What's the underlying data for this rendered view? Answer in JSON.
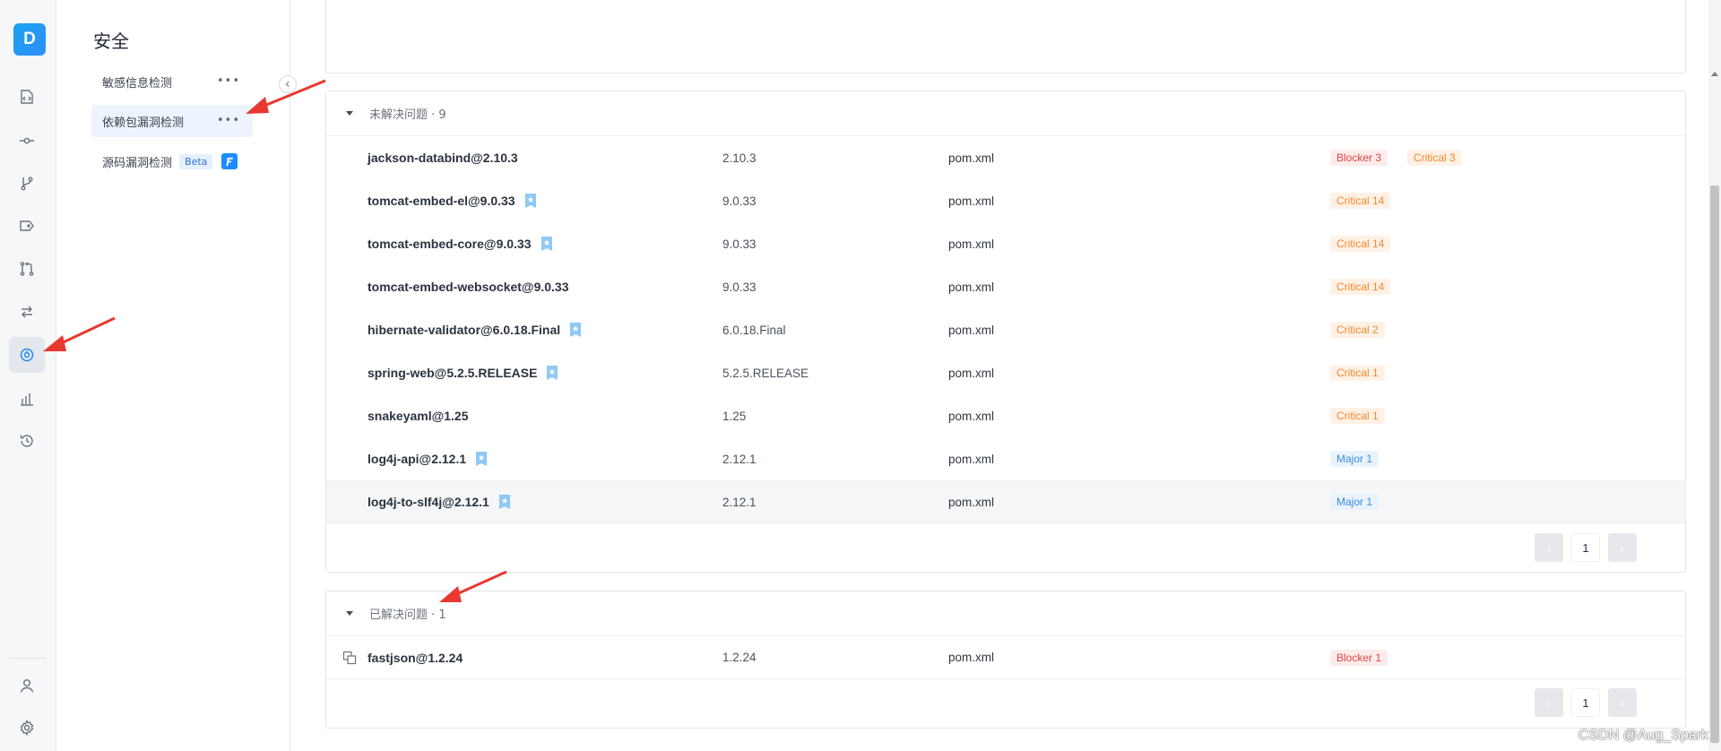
{
  "rail": {
    "logo": "D",
    "icons": [
      "code-icon",
      "commit-icon",
      "branch-icon",
      "tag-icon",
      "pull-request-icon",
      "compare-icon",
      "security-scan-icon",
      "chart-icon",
      "history-icon",
      "user-icon",
      "gear-icon"
    ],
    "active": "security-scan-icon"
  },
  "subnav": {
    "title": "安全",
    "items": [
      {
        "label": "敏感信息检测",
        "more": "•••"
      },
      {
        "label": "依赖包漏洞检测",
        "more": "•••"
      },
      {
        "label": "源码漏洞检测",
        "badge": "Beta"
      }
    ]
  },
  "unresolved": {
    "header": "未解决问题 · 9",
    "rows": [
      {
        "name": "jackson-databind@2.10.3",
        "version": "2.10.3",
        "file": "pom.xml",
        "starred": false,
        "sev": [
          {
            "level": "blocker",
            "label": "Blocker 3"
          },
          {
            "level": "critical",
            "label": "Critical 3"
          }
        ]
      },
      {
        "name": "tomcat-embed-el@9.0.33",
        "version": "9.0.33",
        "file": "pom.xml",
        "starred": true,
        "sev": [
          {
            "level": "critical",
            "label": "Critical 14"
          }
        ]
      },
      {
        "name": "tomcat-embed-core@9.0.33",
        "version": "9.0.33",
        "file": "pom.xml",
        "starred": true,
        "sev": [
          {
            "level": "critical",
            "label": "Critical 14"
          }
        ]
      },
      {
        "name": "tomcat-embed-websocket@9.0.33",
        "version": "9.0.33",
        "file": "pom.xml",
        "starred": false,
        "sev": [
          {
            "level": "critical",
            "label": "Critical 14"
          }
        ]
      },
      {
        "name": "hibernate-validator@6.0.18.Final",
        "version": "6.0.18.Final",
        "file": "pom.xml",
        "starred": true,
        "sev": [
          {
            "level": "critical",
            "label": "Critical 2"
          }
        ]
      },
      {
        "name": "spring-web@5.2.5.RELEASE",
        "version": "5.2.5.RELEASE",
        "file": "pom.xml",
        "starred": true,
        "sev": [
          {
            "level": "critical",
            "label": "Critical 1"
          }
        ]
      },
      {
        "name": "snakeyaml@1.25",
        "version": "1.25",
        "file": "pom.xml",
        "starred": false,
        "sev": [
          {
            "level": "critical",
            "label": "Critical 1"
          }
        ]
      },
      {
        "name": "log4j-api@2.12.1",
        "version": "2.12.1",
        "file": "pom.xml",
        "starred": true,
        "sev": [
          {
            "level": "major",
            "label": "Major 1"
          }
        ]
      },
      {
        "name": "log4j-to-slf4j@2.12.1",
        "version": "2.12.1",
        "file": "pom.xml",
        "starred": true,
        "sev": [
          {
            "level": "major",
            "label": "Major 1"
          }
        ]
      }
    ],
    "pager": {
      "prev": "‹",
      "page": "1",
      "next": "›"
    }
  },
  "resolved": {
    "header": "已解决问题 · 1",
    "rows": [
      {
        "name": "fastjson@1.2.24",
        "version": "1.2.24",
        "file": "pom.xml",
        "sev": [
          {
            "level": "blocker",
            "label": "Blocker 1"
          }
        ]
      }
    ],
    "pager": {
      "prev": "‹",
      "page": "1",
      "next": "›"
    }
  },
  "watermark": "CSDN @Aug_Spark",
  "colors": {
    "accent": "#1a8cff",
    "blocker": "#e1463f",
    "critical": "#f08a2e",
    "major": "#3b8ddc",
    "annotation": "#e8382f"
  }
}
